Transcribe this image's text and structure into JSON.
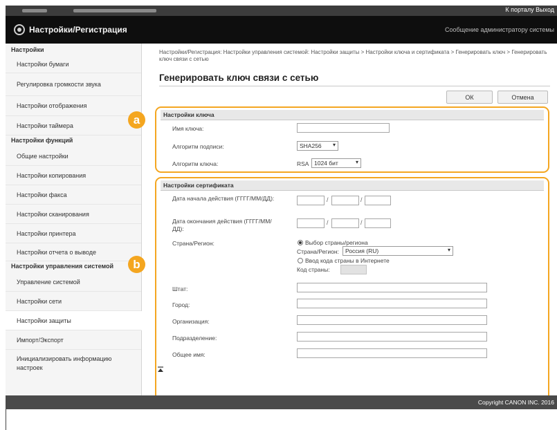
{
  "topbar": {
    "links": "К порталу  Выход"
  },
  "header": {
    "title": "Настройки/Регистрация",
    "admin_message": "Сообщение администратору системы"
  },
  "sidebar": {
    "groups": [
      {
        "heading": "Настройки",
        "items": [
          "Настройки бумаги",
          "Регулировка громкости звука",
          "Настройки отображения",
          "Настройки таймера"
        ]
      },
      {
        "heading": "Настройки функций",
        "items": [
          "Общие настройки",
          "Настройки копирования",
          "Настройки факса",
          "Настройки сканирования",
          "Настройки принтера",
          "Настройки отчета о выводе"
        ]
      },
      {
        "heading": "Настройки управления системой",
        "items": [
          "Управление системой",
          "Настройки сети",
          "Настройки защиты",
          "Импорт/Экспорт",
          "Инициализировать информацию настроек"
        ]
      }
    ],
    "active_item": "Настройки защиты"
  },
  "main": {
    "breadcrumb": "Настройки/Регистрация: Настройки управления системой: Настройки защиты > Настройки ключа и сертификата > Генерировать ключ > Генерировать ключ связи с сетью",
    "page_title": "Генерировать ключ связи с сетью",
    "ok_label": "ОК",
    "cancel_label": "Отмена",
    "key_section": {
      "heading": "Настройки ключа",
      "key_name_label": "Имя ключа:",
      "key_name_value": "",
      "signature_label": "Алгоритм подписи:",
      "signature_value": "SHA256",
      "key_algo_label": "Алгоритм ключа:",
      "key_algo_prefix": "RSA",
      "key_algo_value": "1024 бит"
    },
    "cert_section": {
      "heading": "Настройки сертификата",
      "start_date_label": "Дата начала действия (ГГГГ/ММ/ДД):",
      "end_date_label": "Дата окончания действия (ГГГГ/ММ/ДД):",
      "country_label": "Страна/Регион:",
      "country_option1": "Выбор страны/региона",
      "country_select_label": "Страна/Регион:",
      "country_select_value": "Россия (RU)",
      "country_option2": "Ввод кода страны в Интернете",
      "country_code_label": "Код страны:",
      "state_label": "Штат:",
      "city_label": "Город:",
      "org_label": "Организация:",
      "unit_label": "Подразделение:",
      "common_name_label": "Общее имя:"
    },
    "badge_a": "a",
    "badge_b": "b"
  },
  "footer": {
    "copyright": "Copyright CANON INC. 2016"
  },
  "colors": {
    "accent": "#f4a620",
    "header_bg": "#0e0e0e",
    "footer_bg": "#4a4a4a"
  }
}
